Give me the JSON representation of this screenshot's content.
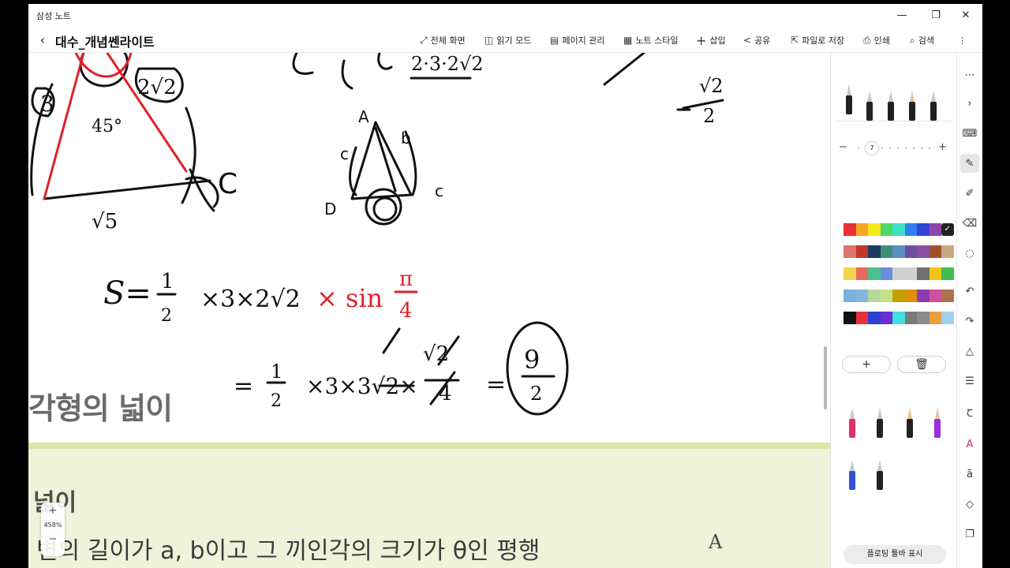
{
  "window": {
    "app_title": "삼성 노트",
    "minimize_icon": "minimize-icon",
    "maximize_icon": "restore-icon",
    "close_icon": "close-icon"
  },
  "toolbar": {
    "note_title": "대수_개념쎈라이트",
    "items": [
      {
        "icon": "fullscreen-icon",
        "glyph": "⤢",
        "label": "전체 화면"
      },
      {
        "icon": "book-icon",
        "glyph": "📖",
        "label": "읽기 모드"
      },
      {
        "icon": "page-icon",
        "glyph": "▤",
        "label": "페이지 관리"
      },
      {
        "icon": "style-icon",
        "glyph": "▦",
        "label": "노트 스타일"
      },
      {
        "icon": "plus-icon",
        "glyph": "+",
        "label": "삽입"
      },
      {
        "icon": "share-icon",
        "glyph": "<",
        "label": "공유"
      },
      {
        "icon": "save-file-icon",
        "glyph": "⇱",
        "label": "파일로 저장"
      },
      {
        "icon": "print-icon",
        "glyph": "⎙",
        "label": "인쇄"
      },
      {
        "icon": "search-icon",
        "glyph": "⌕",
        "label": "검색"
      }
    ],
    "more_glyph": "⋮"
  },
  "page": {
    "heading": "각형의 넓이",
    "subheading": "넓이",
    "body_text": "변의 길이가 a, b이고 그 끼인각의 크기가 θ인 평행",
    "figure_letter": "A"
  },
  "zoom": {
    "plus": "+",
    "value": "458%",
    "minus": "−"
  },
  "pen_panel": {
    "size_value": "7",
    "size_minus": "−",
    "size_plus": "+",
    "add_glyph": "+",
    "delete_glyph": "🗑",
    "floating_toolbar_label": "플로팅 툴바 표시",
    "palette_rows": [
      [
        "#e8303a",
        "#f5a623",
        "#f8e71c",
        "#4cd964",
        "#3ee0c6",
        "#2f80ed",
        "#3146d6",
        "#8e44ad",
        "#222222"
      ],
      [
        "#d9776b",
        "#c0392b",
        "#1e3a5f",
        "#3d8f7a",
        "#5c8fbf",
        "#6c4fa2",
        "#8b4fa2",
        "#a0522d",
        "#c8a882"
      ],
      [
        "#f1d34b",
        "#e86a5a",
        "#4fbf8f",
        "#6a8fe0",
        "#d0d0d0",
        "#d0d0d0",
        "#707070",
        "#f0c419",
        "#3fbf4f"
      ],
      [
        "#7ab0e0",
        "#87b6d8",
        "#b6d99a",
        "#c7e08a",
        "#c4a000",
        "#e09010",
        "#8a3fb0",
        "#d04fa0",
        "#b07050"
      ],
      [
        "#111111",
        "#e8303a",
        "#2f3fd0",
        "#6a2fd0",
        "#3ee0e0",
        "#7a7a7a",
        "#8a8a8a",
        "#e8a040",
        "#a0d0f0"
      ]
    ]
  },
  "tools": [
    {
      "icon": "more-dots-icon",
      "glyph": "⋯"
    },
    {
      "icon": "chevron-right-icon",
      "glyph": "›"
    },
    {
      "icon": "keyboard-icon",
      "glyph": "⌨"
    },
    {
      "icon": "pen-icon",
      "glyph": "✎"
    },
    {
      "icon": "highlighter-icon",
      "glyph": "✐"
    },
    {
      "icon": "eraser-icon",
      "glyph": "⌫"
    },
    {
      "icon": "lasso-icon",
      "glyph": "◌"
    },
    {
      "icon": "undo-icon",
      "glyph": "↶"
    },
    {
      "icon": "redo-icon",
      "glyph": "↷"
    },
    {
      "icon": "shape-icon",
      "glyph": "△"
    },
    {
      "icon": "text-align-icon",
      "glyph": "☰"
    },
    {
      "icon": "text-tool-icon",
      "glyph": "Ꞇ"
    },
    {
      "icon": "font-style-icon",
      "glyph": "A"
    },
    {
      "icon": "text-format-icon",
      "glyph": "ā"
    },
    {
      "icon": "shapes-icon",
      "glyph": "◇"
    },
    {
      "icon": "page-copy-icon",
      "glyph": "❐"
    }
  ]
}
